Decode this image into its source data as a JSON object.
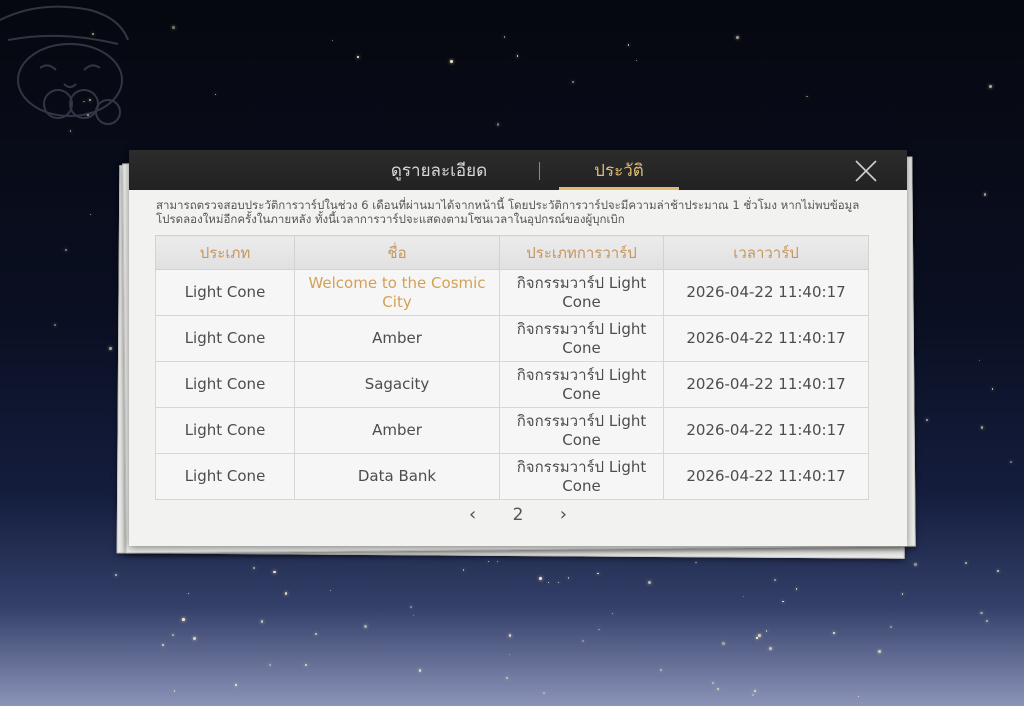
{
  "tabs": {
    "details_label": "ดูรายละเอียด",
    "history_label": "ประวัติ",
    "active": "history"
  },
  "notice": "สามารถตรวจสอบประวัติการวาร์ปในช่วง 6 เดือนที่ผ่านมาได้จากหน้านี้ โดยประวัติการวาร์ปจะมีความล่าช้าประมาณ 1 ชั่วโมง หากไม่พบข้อมูล โปรดลองใหม่อีกครั้งในภายหลัง ทั้งนี้เวลาการวาร์ปจะแสดงตามโซนเวลาในอุปกรณ์ของผู้บุกเบิก",
  "table": {
    "headers": [
      "ประเภท",
      "ชื่อ",
      "ประเภทการวาร์ป",
      "เวลาวาร์ป"
    ],
    "rows": [
      {
        "type": "Light Cone",
        "name": "Welcome to the Cosmic City",
        "warp_type": "กิจกรรมวาร์ป Light Cone",
        "time": "2026-04-22 11:40:17",
        "highlight": true
      },
      {
        "type": "Light Cone",
        "name": "Amber",
        "warp_type": "กิจกรรมวาร์ป Light Cone",
        "time": "2026-04-22 11:40:17",
        "highlight": false
      },
      {
        "type": "Light Cone",
        "name": "Sagacity",
        "warp_type": "กิจกรรมวาร์ป Light Cone",
        "time": "2026-04-22 11:40:17",
        "highlight": false
      },
      {
        "type": "Light Cone",
        "name": "Amber",
        "warp_type": "กิจกรรมวาร์ป Light Cone",
        "time": "2026-04-22 11:40:17",
        "highlight": false
      },
      {
        "type": "Light Cone",
        "name": "Data Bank",
        "warp_type": "กิจกรรมวาร์ป Light Cone",
        "time": "2026-04-22 11:40:17",
        "highlight": false
      }
    ]
  },
  "pager": {
    "current_page": "2",
    "prev_icon": "chevron-left-icon",
    "next_icon": "chevron-right-icon"
  },
  "colors": {
    "accent": "#e1bb75",
    "header_text": "#c7965b",
    "highlight_text": "#d4a055",
    "panel_bg": "#f2f2f1",
    "header_bg": "#262626"
  }
}
